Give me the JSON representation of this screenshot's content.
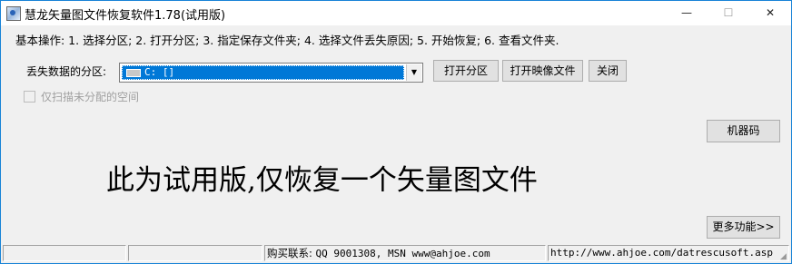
{
  "window": {
    "title": "慧龙矢量图文件恢复软件1.78(试用版)",
    "minimize_glyph": "—",
    "maximize_glyph": "☐",
    "close_glyph": "✕"
  },
  "steps_text": "基本操作: 1. 选择分区; 2. 打开分区; 3. 指定保存文件夹; 4. 选择文件丢失原因; 5. 开始恢复; 6. 查看文件夹.",
  "partition": {
    "label": "丢失数据的分区:",
    "selected": "C: []",
    "dropdown_glyph": "▼"
  },
  "buttons": {
    "open_partition": "打开分区",
    "open_image": "打开映像文件",
    "close": "关闭",
    "machine_code": "机器码",
    "more_features": "更多功能>>"
  },
  "checkbox": {
    "label": "仅扫描未分配的空间",
    "checked": false,
    "enabled": false
  },
  "trial_notice": "此为试用版,仅恢复一个矢量图文件",
  "status": {
    "pane1": "",
    "pane2": "",
    "contact_label": "购买联系:",
    "contact_value": "QQ 9001308, MSN www@ahjoe.com",
    "url": "http://www.ahjoe.com/datrescusoft.asp"
  }
}
